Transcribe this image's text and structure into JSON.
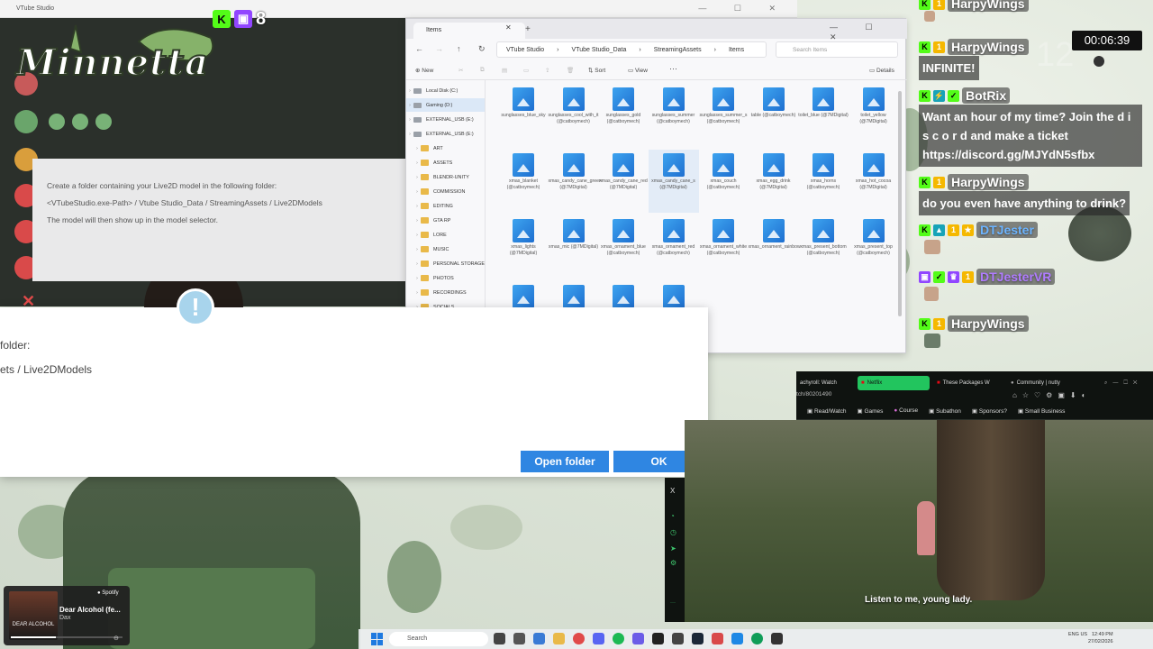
{
  "vts_window": {
    "title": "VTube Studio"
  },
  "logo": {
    "text": "Minnetta"
  },
  "live_badges": {
    "kick_label": "K",
    "count": "8"
  },
  "vts_info": {
    "line1": "Create a folder containing your Live2D model in the following folder:",
    "line2": "<VTubeStudio.exe-Path> / Vtube Studio_Data / StreamingAssets / Live2DModels",
    "line3": "The model will then show up in the model selector."
  },
  "explorer": {
    "tab_title": "Items",
    "tab_close": "✕",
    "new_tab": "+",
    "window_controls": "—  ☐  ✕",
    "path": [
      "VTube Studio",
      "VTube Studio_Data",
      "StreamingAssets",
      "Items"
    ],
    "search_placeholder": "Search Items",
    "toolbar": {
      "new": "New",
      "sort": "Sort",
      "view": "View",
      "more": "···",
      "details": "Details"
    },
    "sidebar": [
      {
        "label": "Local Disk (C:)",
        "type": "drive"
      },
      {
        "label": "Gaming (D:)",
        "type": "drive"
      },
      {
        "label": "EXTERNAL_USB (E:)",
        "type": "drive"
      },
      {
        "label": "EXTERNAL_USB (E:)",
        "type": "drive"
      },
      {
        "label": "ART",
        "type": "folder"
      },
      {
        "label": "ASSETS",
        "type": "folder"
      },
      {
        "label": "BLENDR-UNITY",
        "type": "folder"
      },
      {
        "label": "COMMISSION",
        "type": "folder"
      },
      {
        "label": "EDITING",
        "type": "folder"
      },
      {
        "label": "GTA RP",
        "type": "folder"
      },
      {
        "label": "LORE",
        "type": "folder"
      },
      {
        "label": "MUSIC",
        "type": "folder"
      },
      {
        "label": "PERSONAL STORAGE",
        "type": "folder"
      },
      {
        "label": "PHOTOS",
        "type": "folder"
      },
      {
        "label": "RECORDINGS",
        "type": "folder"
      },
      {
        "label": "SOCIALS",
        "type": "folder"
      }
    ],
    "files": [
      [
        "sunglasses_blue_sky",
        "sunglasses_cool_with_it (@catboymech)",
        "sunglasses_gold (@catboymech)",
        "sunglasses_summer (@catboymech)",
        "sunglasses_summer_s (@catboymech)",
        "table (@catboymech)",
        "toilet_blue (@7MDigital)",
        "toilet_yellow (@7MDigital)"
      ],
      [
        "xmas_blanket (@catboymech)",
        "xmas_candy_cane_green (@7MDigital)",
        "xmas_candy_cane_red (@7MDigital)",
        "xmas_candy_cane_s (@7MDigital)",
        "xmas_couch (@catboymech)",
        "xmas_egg_drink (@7MDigital)",
        "xmas_horns (@catboymech)",
        "xmas_hot_cocoa (@7MDigital)"
      ],
      [
        "xmas_lights (@7MDigital)",
        "xmas_mic (@7MDigital)",
        "xmas_ornament_blue (@catboymech)",
        "xmas_ornament_red (@catboymech)",
        "xmas_ornament_white (@catboymech)",
        "xmas_ornament_rainbow",
        "xmas_present_bottom (@catboymech)",
        "xmas_present_top (@catboymech)"
      ],
      [
        "",
        "",
        "",
        ""
      ]
    ]
  },
  "dialog": {
    "text1": "folder:",
    "text2": "ets / Live2DModels",
    "icon": "!",
    "open_folder": "Open folder",
    "ok": "OK"
  },
  "chat": {
    "timer": "00:06:39",
    "timer_bg": "12",
    "messages": [
      {
        "user": "HarpyWings",
        "text": "INFINITE!"
      },
      {
        "user": "BotRix",
        "text": "Want an hour of my time? Join the d i s c o r d and make a ticket https://discord.gg/MJYdN5sfbx"
      },
      {
        "user": "HarpyWings",
        "text": "do you even have anything to drink?"
      },
      {
        "user": "DTJester",
        "text": ""
      },
      {
        "user": "DTJesterVR",
        "text": ""
      },
      {
        "user": "HarpyWings",
        "text": ""
      }
    ],
    "colors": {
      "kick": "#53fc18",
      "twitch": "#9146ff",
      "gold": "#f5b800",
      "teal": "#18a3b8"
    }
  },
  "browser": {
    "tabs": [
      "achyroll: Watch",
      "Netflix",
      "These Packages W",
      "Community | nutty"
    ],
    "url": "tch/80201490",
    "bookmarks": [
      "Read/Watch",
      "Games",
      "Course",
      "Subathon",
      "Sponsors?",
      "Small Business"
    ],
    "subtitle": "Listen to me, young lady."
  },
  "spotify": {
    "brand": "Spotify",
    "title": "Dear Alcohol (fe...",
    "artist": "Dax",
    "album_art_text": "DEAR ALCOHOL",
    "progress": 0.4
  },
  "taskbar": {
    "search": "Search",
    "lang": "ENG US",
    "time": "12:49 PM",
    "date": "27/02/2026"
  }
}
